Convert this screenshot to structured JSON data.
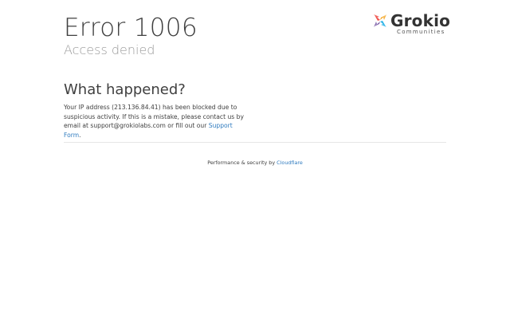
{
  "error": {
    "title": "Error 1006",
    "subtitle": "Access denied"
  },
  "logo": {
    "name": "Grokio",
    "tagline": "Communities",
    "icon": "grokio-logo-icon",
    "colors": [
      "#f0524c",
      "#f5a623",
      "#2fb5e8",
      "#7b5ea7"
    ]
  },
  "what_happened": {
    "heading": "What happened?",
    "text_before": "Your IP address (213.136.84.41) has been blocked due to suspicious activity. If this is a mistake, please contact us by email at support@grokiolabs.com or fill out our ",
    "link_label": "Support Form",
    "text_after": "."
  },
  "footer": {
    "prefix": "Performance & security by ",
    "link_label": "Cloudflare"
  },
  "colors": {
    "link": "#2f7bbf",
    "text": "#404040",
    "muted": "#9a9a9a"
  }
}
